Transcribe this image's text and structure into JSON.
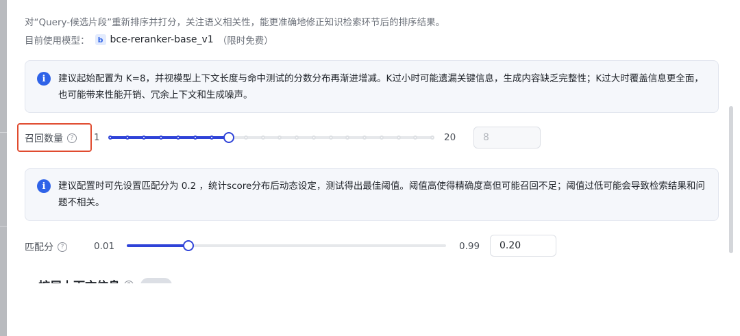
{
  "intro": {
    "description": "对“Query-候选片段”重新排序并打分，关注语义相关性，能更准确地修正知识检索环节后的排序结果。",
    "model_label": "目前使用模型：",
    "model_icon": "b",
    "model_name": "bce-reranker-base_v1",
    "model_tag": "（限时免费）"
  },
  "tip_recall": {
    "icon": "info-icon",
    "text": "建议起始配置为 K=8，并视模型上下文长度与命中测试的分数分布再渐进增减。K过小时可能遗漏关键信息，生成内容缺乏完整性；K过大时覆盖信息更全面，也可能带来性能开销、冗余上下文和生成噪声。"
  },
  "recall": {
    "label": "召回数量",
    "help_icon": "question-circle-icon",
    "min_label": "1",
    "max_label": "20",
    "min": 1,
    "max": 20,
    "value": 8,
    "input_value": "8",
    "input_disabled": true,
    "highlight_color": "#e04b2f"
  },
  "tip_score": {
    "icon": "info-icon",
    "text": "建议配置时可先设置匹配分为 0.2 ，统计score分布后动态设定，测试得出最佳阈值。阈值高使得精确度高但可能召回不足；阈值过低可能会导致检索结果和问题不相关。"
  },
  "score": {
    "label": "匹配分",
    "help_icon": "question-circle-icon",
    "min_label": "0.01",
    "max_label": "0.99",
    "min": 0.01,
    "max": 0.99,
    "value": 0.2,
    "input_value": "0.20"
  },
  "expand_context": {
    "label": "扩展上下文信息",
    "help_icon": "question-circle-icon"
  },
  "colors": {
    "accent": "#2f43d8",
    "info": "#2f63e8",
    "highlight": "#e04b2f"
  }
}
